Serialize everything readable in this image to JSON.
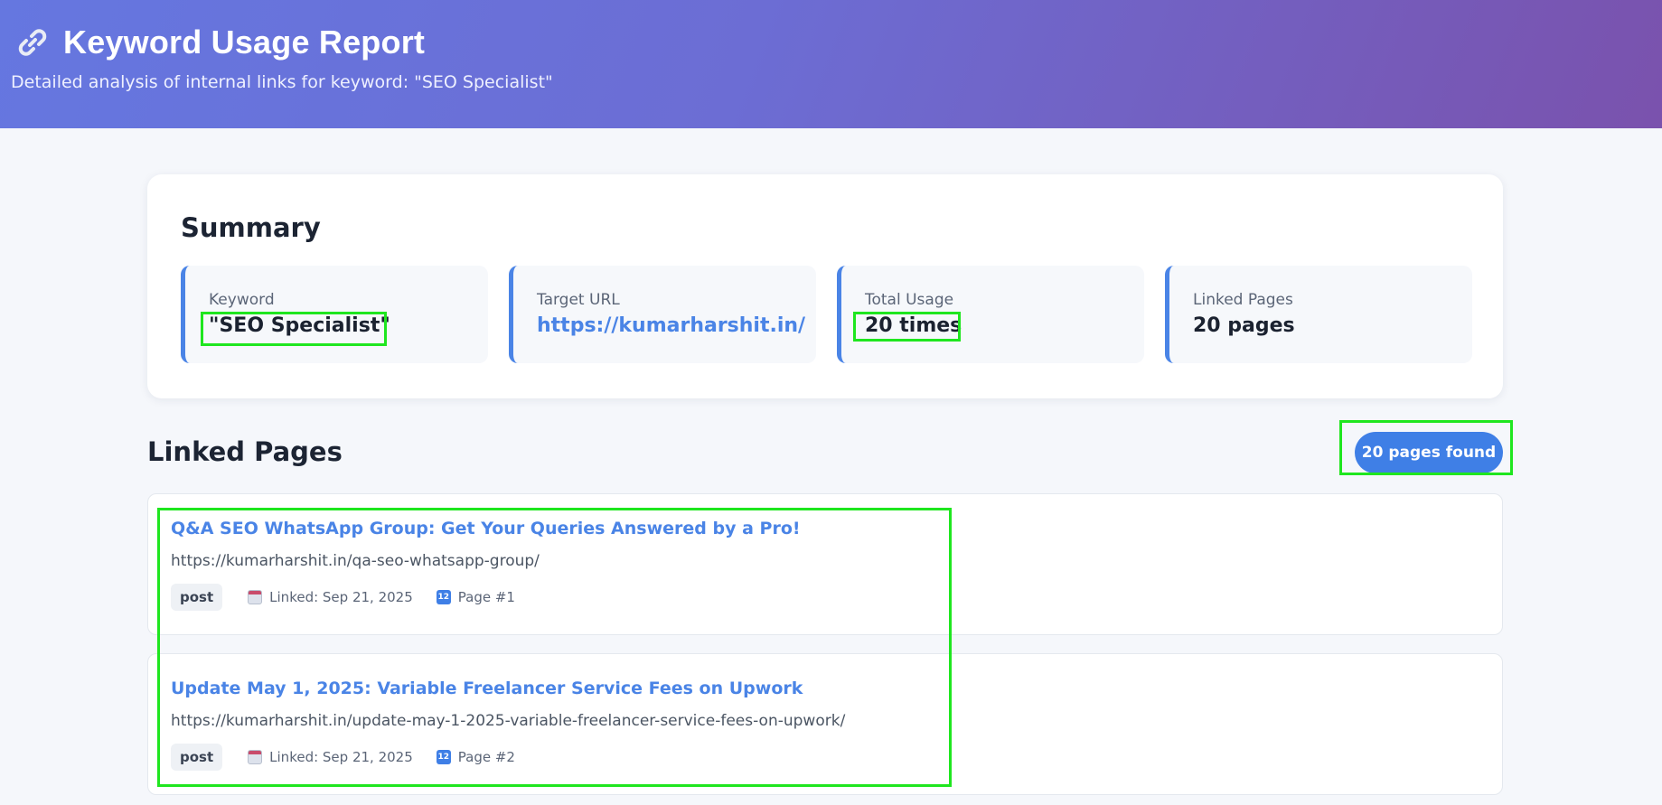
{
  "header": {
    "title": "Keyword Usage Report",
    "subtitle": "Detailed analysis of internal links for keyword: \"SEO Specialist\"",
    "icon": "link-icon"
  },
  "summary": {
    "heading": "Summary",
    "stats": [
      {
        "label": "Keyword",
        "value": "\"SEO Specialist\""
      },
      {
        "label": "Target URL",
        "value": "https://kumarharshit.in/"
      },
      {
        "label": "Total Usage",
        "value": "20 times"
      },
      {
        "label": "Linked Pages",
        "value": "20 pages"
      }
    ]
  },
  "linked": {
    "heading": "Linked Pages",
    "count_badge": "20 pages found",
    "pages": [
      {
        "title": "Q&A SEO WhatsApp Group: Get Your Queries Answered by a Pro!",
        "url": "https://kumarharshit.in/qa-seo-whatsapp-group/",
        "type": "post",
        "linked": "Linked: Sep 21, 2025",
        "page_no": "Page #1"
      },
      {
        "title": "Update May 1, 2025: Variable Freelancer Service Fees on Upwork",
        "url": "https://kumarharshit.in/update-may-1-2025-variable-freelancer-service-fees-on-upwork/",
        "type": "post",
        "linked": "Linked: Sep 21, 2025",
        "page_no": "Page #2"
      }
    ]
  },
  "colors": {
    "accent": "#4a84e6",
    "highlight": "#1fe61f",
    "header_start": "#6577e0",
    "header_end": "#7a52ad"
  }
}
